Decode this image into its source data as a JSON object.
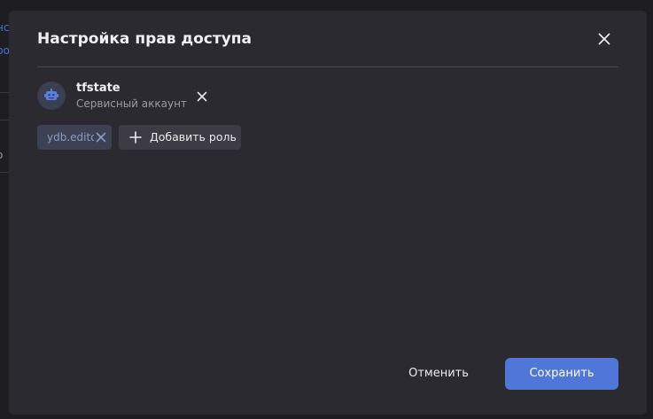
{
  "background": {
    "fragment_1": "нс",
    "fragment_2": "ро",
    "fragment_3": "о"
  },
  "dialog": {
    "title": "Настройка прав доступа",
    "account": {
      "name": "tfstate",
      "type": "Сервисный аккаунт",
      "icon": "robot-icon"
    },
    "roles": [
      {
        "label": "ydb.editor"
      }
    ],
    "add_role_label": "Добавить роль",
    "cancel_label": "Отменить",
    "save_label": "Сохранить"
  },
  "colors": {
    "accent": "#5076d8",
    "modal_bg": "#2b2a31",
    "chip_bg": "#3c4154"
  }
}
